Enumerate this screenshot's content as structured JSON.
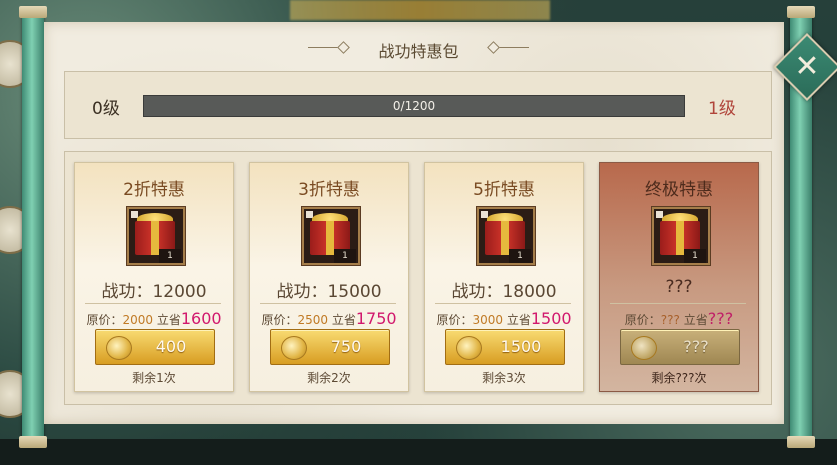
{
  "panel": {
    "title": "战功特惠包",
    "close_icon": "close-icon"
  },
  "progress": {
    "current_level": "0级",
    "next_level": "1级",
    "text": "0/1200",
    "current": 0,
    "max": 1200
  },
  "packs": [
    {
      "title": "2折特惠",
      "merit": "战功：12000",
      "orig_label": "原价：",
      "orig_value": "2000",
      "save_label": "立省",
      "save_value": "1600",
      "price": "400",
      "remaining": "剩余1次",
      "count": "1"
    },
    {
      "title": "3折特惠",
      "merit": "战功：15000",
      "orig_label": "原价：",
      "orig_value": "2500",
      "save_label": "立省",
      "save_value": "1750",
      "price": "750",
      "remaining": "剩余2次",
      "count": "1"
    },
    {
      "title": "5折特惠",
      "merit": "战功：18000",
      "orig_label": "原价：",
      "orig_value": "3000",
      "save_label": "立省",
      "save_value": "1500",
      "price": "1500",
      "remaining": "剩余3次",
      "count": "1"
    },
    {
      "title": "终极特惠",
      "merit": "???",
      "orig_label": "原价：",
      "orig_value": "???",
      "save_label": "立省",
      "save_value": "???",
      "price": "???",
      "remaining": "剩余???次",
      "count": "1"
    }
  ],
  "colors": {
    "scroll_green": "#3f8b74",
    "accent_gold": "#d89d22",
    "save_red": "#d1186d",
    "level_red": "#b0443a"
  }
}
